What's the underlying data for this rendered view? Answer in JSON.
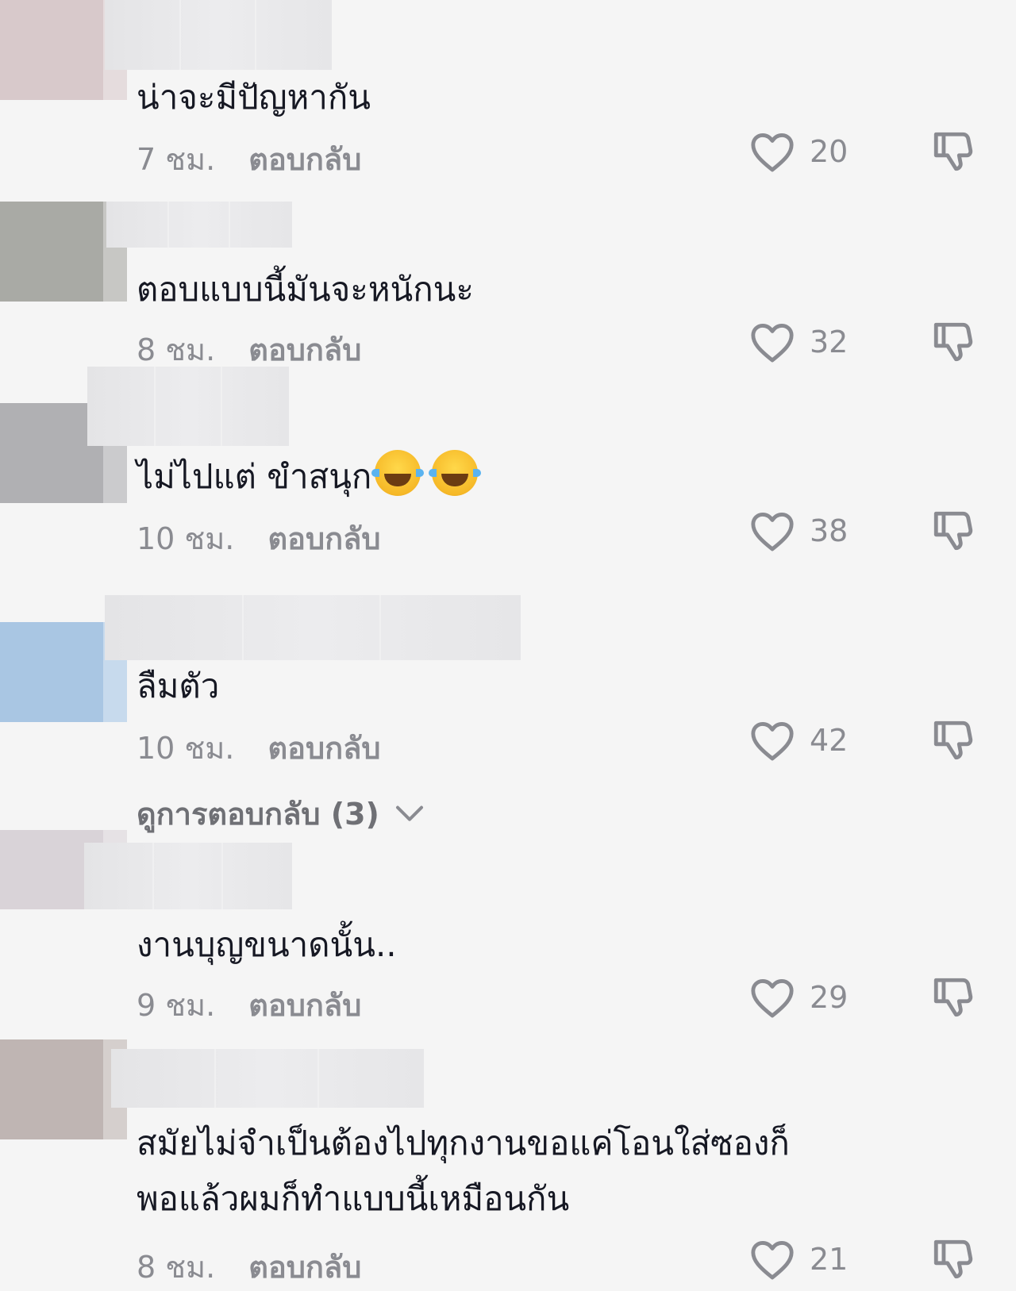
{
  "comments": [
    {
      "text": "น่าจะมีปัญหากัน",
      "time": "7 ชม.",
      "reply": "ตอบกลับ",
      "likes": "20",
      "avatar_color": "#d8c9cb"
    },
    {
      "text": "ตอบแบบนี้มันจะหนักนะ",
      "time": "8 ชม.",
      "reply": "ตอบกลับ",
      "likes": "32",
      "avatar_color": "#a9aaa5"
    },
    {
      "text": "ไม่ไปแต่ ขำสนุก",
      "time": "10 ชม.",
      "reply": "ตอบกลับ",
      "likes": "38",
      "avatar_color": "#b0b0b3",
      "emojis": [
        "face-with-tears-of-joy-icon",
        "face-with-tears-of-joy-icon"
      ]
    },
    {
      "text": "ลืมตัว",
      "time": "10 ชม.",
      "reply": "ตอบกลับ",
      "likes": "42",
      "avatar_color": "#a9c6e3"
    },
    {
      "text": "งานบุญขนาดนั้น..",
      "time": "9 ชม.",
      "reply": "ตอบกลับ",
      "likes": "29",
      "avatar_color": "#d9d3d8"
    },
    {
      "text_line1": "สมัยไม่จำเป็นต้องไปทุกงานขอแค่โอนใส่ซองก็",
      "text_line2": "พอแล้วผมก็ทำแบบนี้เหมือนกัน",
      "time": "8 ชม.",
      "reply": "ตอบกลับ",
      "likes": "21",
      "avatar_color": "#bfb5b3"
    }
  ],
  "view_replies": "ดูการตอบกลับ (3)",
  "icons": {
    "like": "heart-outline-icon",
    "dislike": "thumbs-down-icon",
    "expand": "chevron-down-icon"
  }
}
